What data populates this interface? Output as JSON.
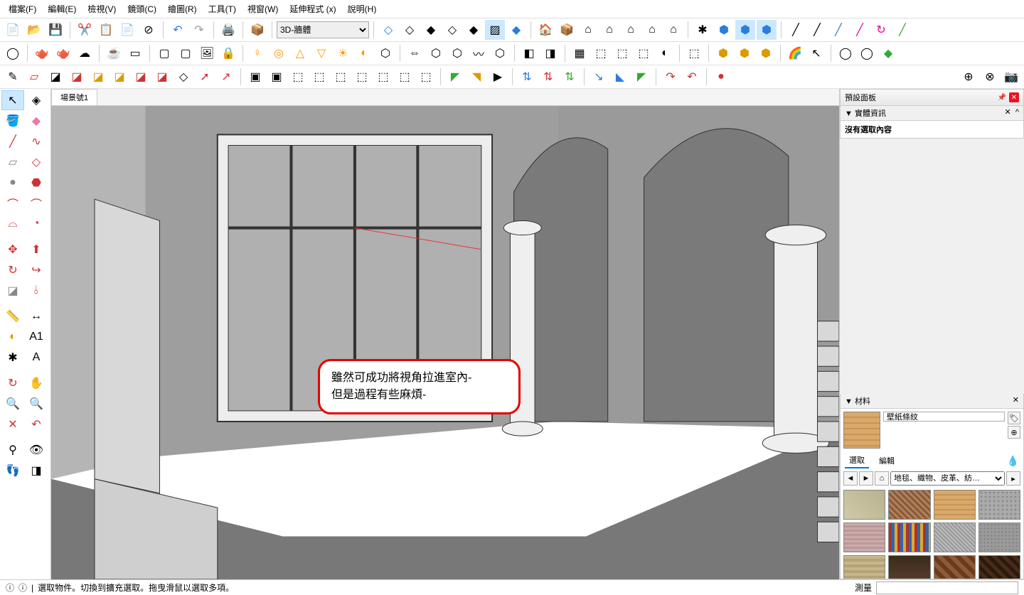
{
  "menu": {
    "file": "檔案(F)",
    "edit": "編輯(E)",
    "view": "檢視(V)",
    "camera": "鏡頭(C)",
    "draw": "繪圖(R)",
    "tools": "工具(T)",
    "window": "視窗(W)",
    "ext": "延伸程式 (x)",
    "help": "說明(H)"
  },
  "style_select": "3D-牆體",
  "scene_tab": "場景號1",
  "callout": {
    "line1": "雖然可成功將視角拉進室內-",
    "line2": "但是過程有些麻煩-"
  },
  "panels": {
    "preset_title": "預設面板",
    "entity_title": "▼ 實體資訊",
    "entity_body": "沒有選取內容",
    "materials_title": "▼ 材料",
    "material_name": "壁紙條紋",
    "tab_select": "選取",
    "tab_edit": "編輯",
    "material_category": "地毯、織物、皮革、紡…"
  },
  "status": {
    "hint": "選取物件。切換到擴充選取。拖曳滑鼠以選取多項。",
    "measure_label": "測量"
  },
  "swatches": [
    "linear-gradient(45deg,#cfc9a8,#b8b28f)",
    "repeating-linear-gradient(45deg,#8a5a3a,#8a5a3a 3px,#b0835d 3px,#b0835d 6px)",
    "repeating-linear-gradient(#d9a96b,#d9a96b 5px,#c99352 5px,#c99352 7px)",
    "radial-gradient(#888 30%,#aaa 31%) 0 0/6px 6px",
    "repeating-linear-gradient(#caa,#caa 3px,#b99 3px,#b99 6px)",
    "repeating-linear-gradient(90deg,#a33,#a33 4px,#36a 4px,#36a 8px,#da3 8px,#da3 12px)",
    "repeating-linear-gradient(45deg,#999,#999 2px,#bbb 2px,#bbb 4px)",
    "radial-gradient(#7a7a7a 25%,#9a9a9a 26%) 0 0/5px 5px",
    "repeating-linear-gradient(#c7b68a,#c7b68a 4px,#b5a378 4px,#b5a378 8px)",
    "linear-gradient(#3a2a1a,#5a4030)",
    "repeating-linear-gradient(45deg,#6a3a1a,#6a3a1a 6px,#8a5a3a 6px,#8a5a3a 12px)",
    "repeating-linear-gradient(45deg,#4a2a1a,#4a2a1a 5px,#2a1a0a 5px,#2a1a0a 10px)"
  ]
}
